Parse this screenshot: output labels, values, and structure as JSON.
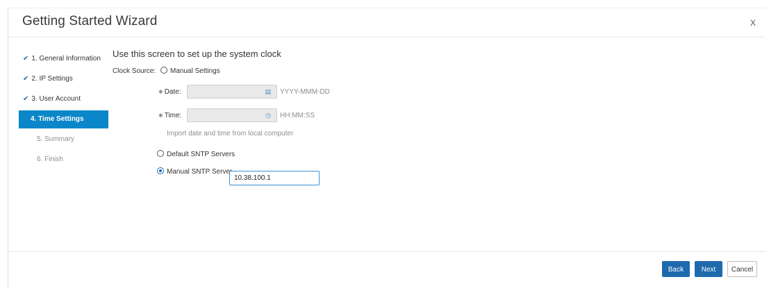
{
  "window": {
    "title": "Getting Started Wizard",
    "close_label": "X"
  },
  "steps": [
    {
      "label": "1. General Information",
      "state": "done"
    },
    {
      "label": "2. IP Settings",
      "state": "done"
    },
    {
      "label": "3. User Account",
      "state": "done"
    },
    {
      "label": "4. Time Settings",
      "state": "active"
    },
    {
      "label": "5. Summary",
      "state": "pending"
    },
    {
      "label": "6. Finish",
      "state": "pending"
    }
  ],
  "check_glyph": "✔",
  "main": {
    "heading": "Use this screen to set up the system clock",
    "clock_source_label": "Clock Source:",
    "manual_settings_label": "Manual Settings",
    "date_label": "Date:",
    "date_value": "",
    "date_format": "YYYY-MMM-DD",
    "time_label": "Time:",
    "time_value": "",
    "time_format": "HH:MM:SS",
    "import_text": "Import date and time from local computer",
    "default_sntp_label": "Default SNTP Servers",
    "manual_sntp_label": "Manual SNTP Server",
    "manual_sntp_value": "10.38.100.1",
    "selected_option": "Manual SNTP Server"
  },
  "footer": {
    "back_label": "Back",
    "next_label": "Next",
    "cancel_label": "Cancel"
  },
  "colors": {
    "accent": "#0b87c9",
    "button_primary": "#1f6aad",
    "input_focus": "#3a92d6"
  }
}
